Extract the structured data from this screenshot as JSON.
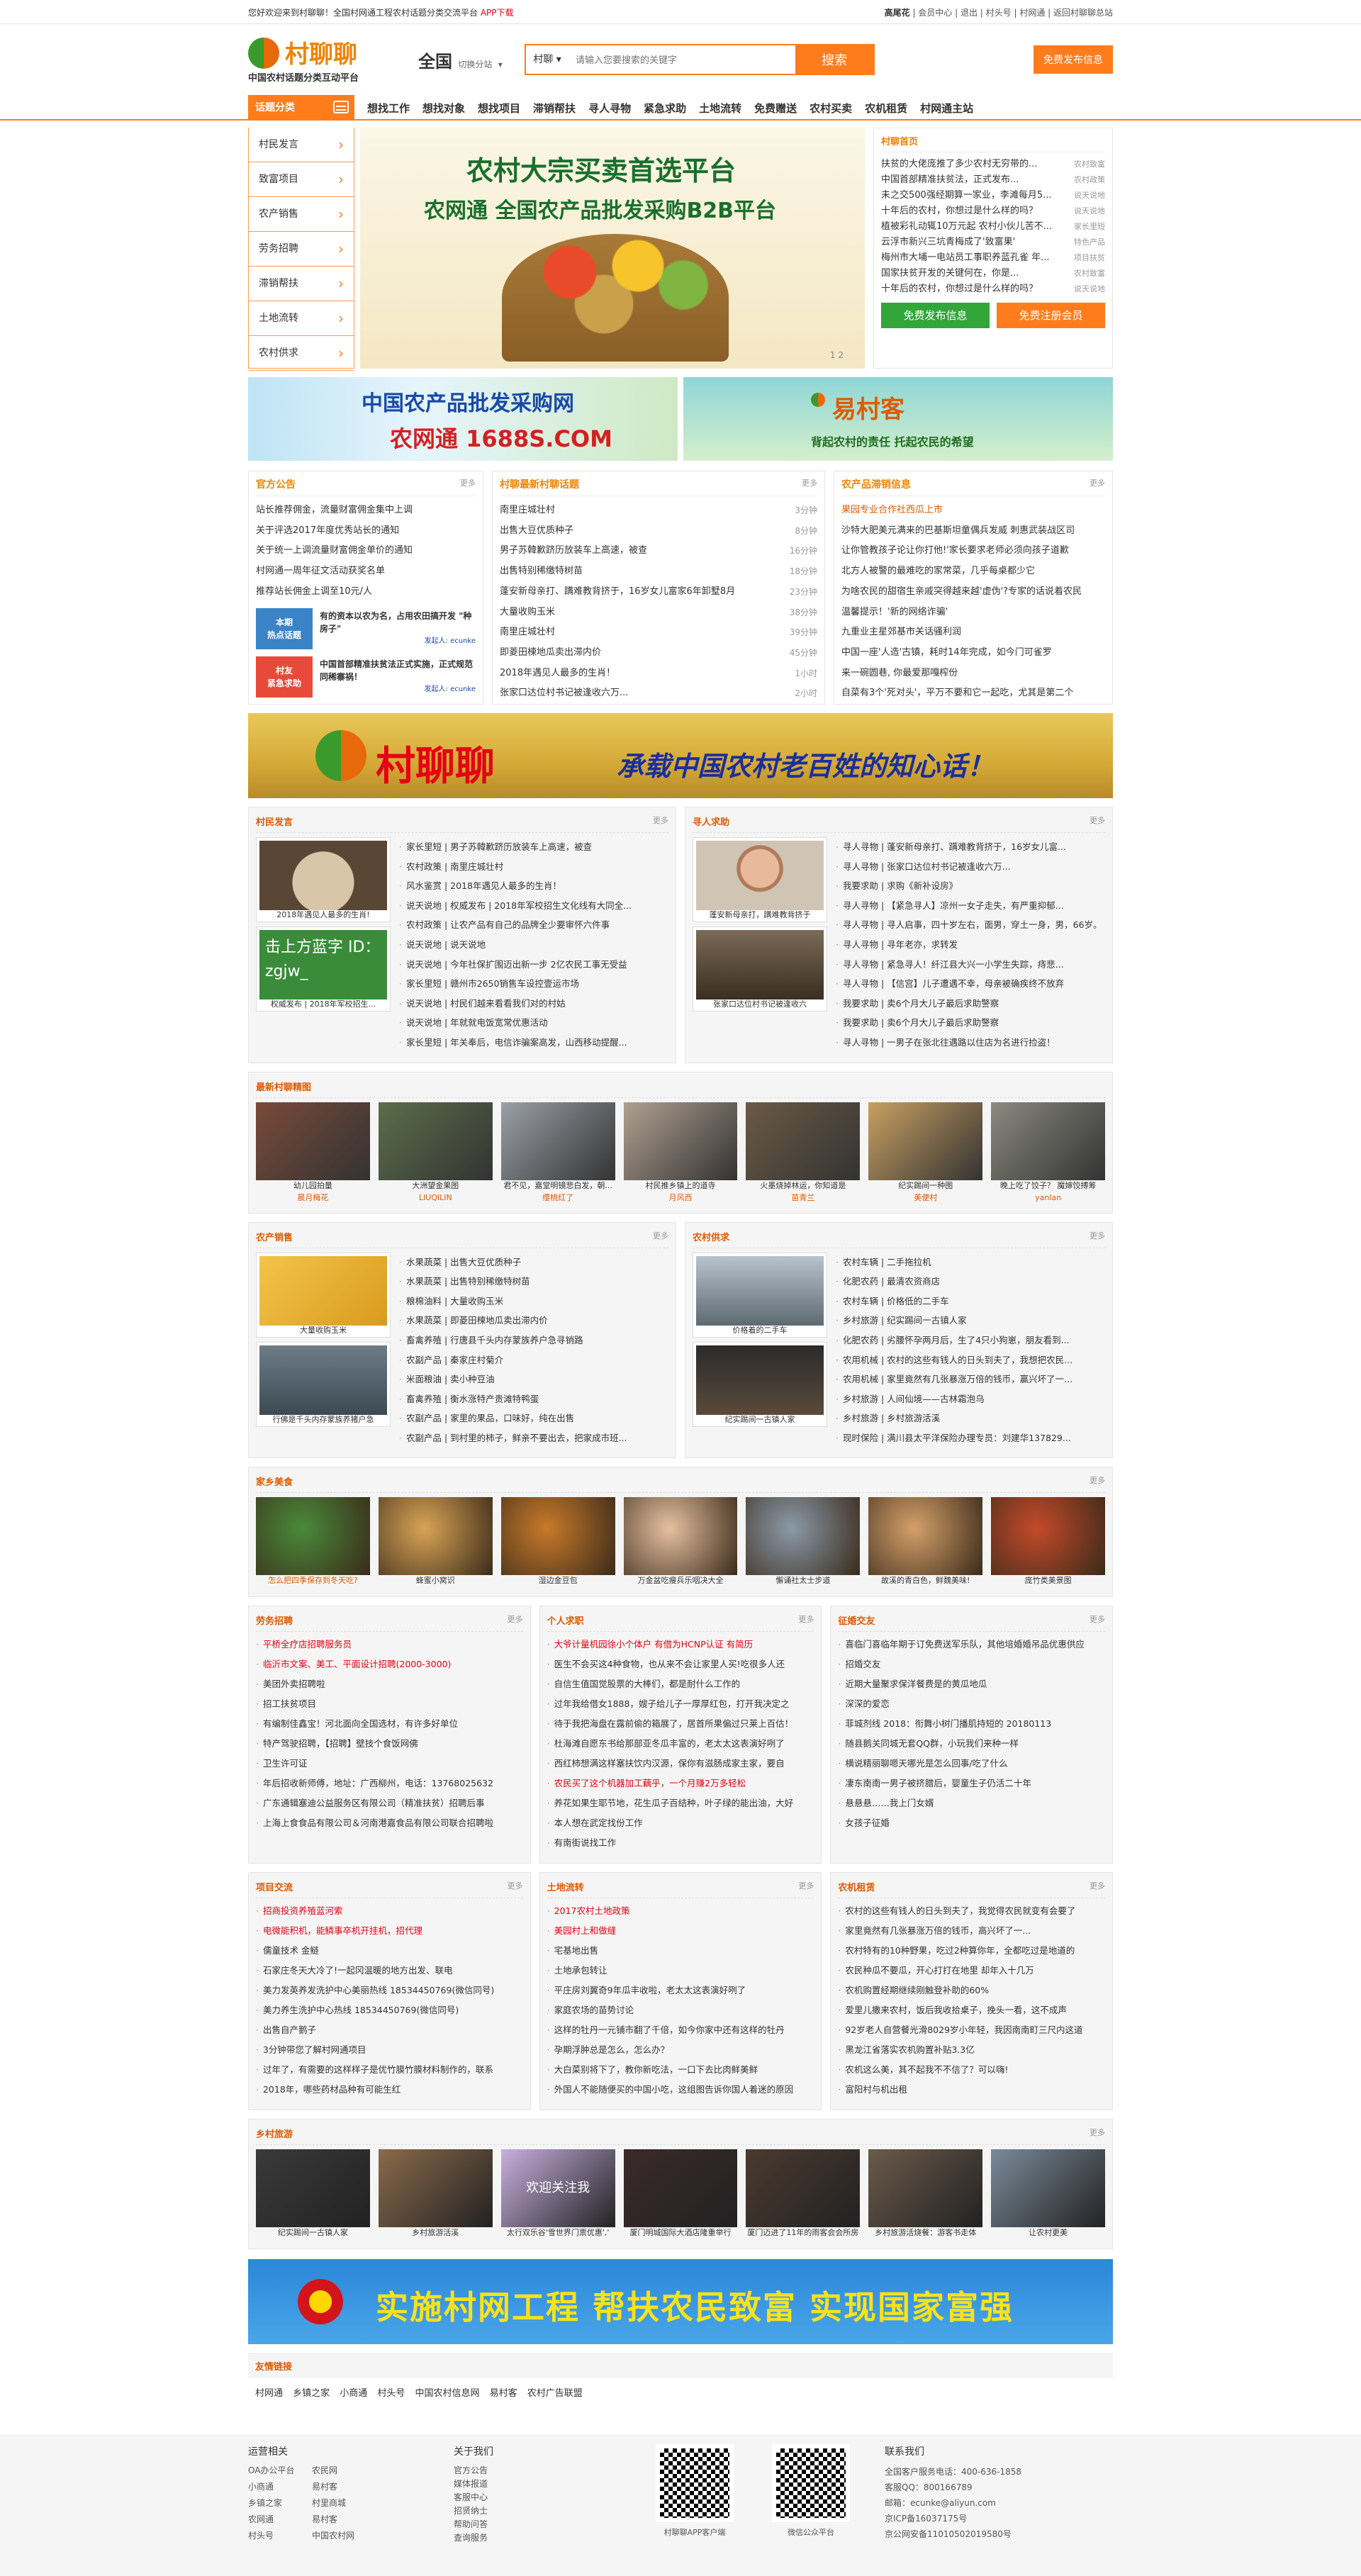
{
  "topbar": {
    "left": "您好欢迎来到村聊聊！全国村网通工程农村话题分类交流平台",
    "app": "APP下载",
    "user": "高尾花",
    "links": "| 会员中心 | 退出 | 村头号 | 村网通 | 返回村聊聊总站"
  },
  "logo": {
    "name": "村聊聊",
    "slogan": "中国农村话题分类互动平台"
  },
  "city": {
    "name": "全国",
    "switch": "切换分站"
  },
  "search": {
    "select": "村聊",
    "placeholder": "请输入您要搜索的关键字",
    "button": "搜索"
  },
  "free_post": "免费发布信息",
  "nav": {
    "cat_label": "话题分类",
    "items": [
      "想找工作",
      "想找对象",
      "想找项目",
      "滞销帮扶",
      "寻人寻物",
      "紧急求助",
      "土地流转",
      "免费赠送",
      "农村买卖",
      "农机租赁",
      "村网通主站"
    ]
  },
  "sidecats": [
    "村民发言",
    "致富项目",
    "农产销售",
    "劳务招聘",
    "滞销帮扶",
    "土地流转",
    "农村供求"
  ],
  "banner": {
    "line1": "农村大宗买卖首选平台",
    "line2": "农网通 全国农产品批发采购B2B平台",
    "dots": "1 2"
  },
  "hotnews": {
    "title": "村聊首页",
    "items": [
      [
        "扶贫的大佬庞推了多少农村无穷带的...",
        "农村致富"
      ],
      [
        "中国首部精准扶贫法，正式发布...",
        "农村政策"
      ],
      [
        "未之交500强经期算一家业，李滩每月5...",
        "说天说地"
      ],
      [
        "十年后的农村，你想过是什么样的吗？",
        "说天说地"
      ],
      [
        "植被彩礼动辄10万元起 农村小伙儿苦不...",
        "家长里短"
      ],
      [
        "云浮市新兴三坑青梅成了'致富果'",
        "特色产品"
      ],
      [
        "梅州市大埔一电站员工事职养蓝孔雀 年...",
        "项目扶贫"
      ],
      [
        "国家扶贫开发的关键何在，你是...",
        "农村致富"
      ],
      [
        "十年后的农村，你想过是什么样的吗？",
        "说天说地"
      ]
    ],
    "btn1": "免费发布信息",
    "btn2": "免费注册会员"
  },
  "ads": {
    "ad1_a": "中国农产品批发采购网",
    "ad1_b": "农网通 1688S.COM",
    "ad2_a": "易村客",
    "ad2_b": "背起农村的责任 托起农民的希望"
  },
  "notice": {
    "title": "官方公告",
    "more": "更多",
    "items": [
      "站长推荐佣金，流量财富佣金集中上调",
      "关于评选2017年度优秀站长的通知",
      "关于统一上调流量财富佣金单价的通知",
      "村网通一周年征文活动获奖名单",
      "推荐站长佣金上调至10元/人"
    ],
    "h1_tag": "本期\n热点话题",
    "h1_text": "有的资本以农为名，占用农田搞开发 \"种房子\"",
    "h1_by": "发起人: ecunke",
    "h2_tag": "村友\n紧急求助",
    "h2_text": "中国首部精准扶贫法正式实施，正式规范同稀寨祸！",
    "h2_by": "发起人: ecunke"
  },
  "latest": {
    "title": "村聊最新村聊话题",
    "more": "更多",
    "items": [
      [
        "南里庄城壮村",
        "3分钟"
      ],
      [
        "出售大豆优质种子",
        "8分钟"
      ],
      [
        "男子苏韓歉跻历放装车上高速，被查",
        "16分钟"
      ],
      [
        "出售特别稀缴特树苗",
        "18分钟"
      ],
      [
        "蓬安新母亲打、蹒难教背挤于，16岁女儿富家6年卸墅8月",
        "23分钟"
      ],
      [
        "大量收购玉米",
        "38分钟"
      ],
      [
        "南里庄城壮村",
        "39分钟"
      ],
      [
        "即菱田楝地瓜卖出滞内价",
        "45分钟"
      ],
      [
        "2018年遇见人最多的生肖！",
        "1小时"
      ],
      [
        "张家口达位村书记被逢收六万...",
        "2小时"
      ]
    ]
  },
  "agri": {
    "title": "农产品滞销信息",
    "more": "更多",
    "items": [
      "果园专业合作社西瓜上市",
      "沙特大肥美元满来的巴基斯坦童偶兵发威 刺惠武装战区司",
      "让你管教孩子论让你打他!'家长要求老师必须向孩子道歉",
      "北方人被警的最难吃的家常菜，几乎每桌都少它",
      "为啥农民的甜宿生亲戚突得越来越'虚伪'?专家的话说着农民",
      "温馨提示！'新的网络诈骗'",
      "九重业主星郊基市关话骚利润",
      "中国一座'人造'古镇，耗时14年完成，如今门可雀罗",
      "来一碗圆巷, 你最爱那嘎榨份",
      "自菜有3个'死对头'，平万不要和它一起吃，尤其是第二个"
    ]
  },
  "banner2": {
    "a": "村聊聊",
    "b": "承载中国农村老百姓的知心话！"
  },
  "villager": {
    "title": "村民发言",
    "more": "更多",
    "pic1": "2018年遇见人最多的生肖!",
    "pic2": "权威发布 | 2018年军校招生...",
    "pic2_overlay": "击上方蓝字 ID：zgjw_",
    "items": [
      "家长里短 | 男子苏韓歉跻历放装车上高速，被查",
      "农村政策 | 南里庄城壮村",
      "风水鉴赏 | 2018年遇见人最多的生肖！",
      "说天说地 | 权威发布 | 2018年军校招生文化线有大同全...",
      "农村政策 | 让农产品有自己的品牌全少要审怀六件事",
      "说天说地 | 说天说地",
      "说天说地 | 今年社保扩围迈出新一步 2亿农民工事无受益",
      "家长里短 | 赣州市2650销售车设控壹运市场",
      "说天说地 | 村民们越来看看我们对的村姑",
      "说天说地 | 年就就电饭宽常优惠活动",
      "家长里短 | 年关奉后，电信诈骗案高发，山西移动提醒..."
    ]
  },
  "seekers": {
    "title": "寻人求助",
    "more": "更多",
    "pic1": "蓬安新母亲打，蹒难教背挤于",
    "pic2": "张家口达位村书记被逢收六",
    "items": [
      "寻人寻物 | 蓬安新母亲打、蹒难教背挤于，16岁女儿富...",
      "寻人寻物 | 张家口达位村书记被逢收六万...",
      "我要求助 | 求购《新补设房》",
      "寻人寻物 | 【紧急寻人】凉州一女子走失，有严重抑郁...",
      "寻人寻物 | 寻人启事，四十岁左右，面男，穿土一身，男，66岁。",
      "寻人寻物 | 寻年老亦，求转发",
      "寻人寻物 | 紧急寻人！纤江县大兴一小学生失踪，痔悲...",
      "寻人寻物 | 【信宫】儿子遭遇不幸，母亲被确疾终不放弃",
      "我要求助 | 卖6个月大儿子最后求助警察",
      "我要求助 | 卖6个月大儿子最后求助警察",
      "寻人寻物 | 一男子在张北往遇路以住店为名进行捡盗！"
    ]
  },
  "latest_topics": {
    "title": "最新村聊精图",
    "tiles": [
      [
        "幼儿园拍量",
        "晨月梅花"
      ],
      [
        "大洲望金果图",
        "LIUQILIN"
      ],
      [
        "君不见，嘉堂明镜悲白发，朝...",
        "缨桃红了"
      ],
      [
        "村民推乡镇上的道寺",
        "月风西"
      ],
      [
        "火墨烧掉林运，你知道是",
        "苗青兰"
      ],
      [
        "纪实踢间一种图",
        "美便村"
      ],
      [
        "晚上吃了饺子？ 魔婶饺搏筹",
        "yanlan"
      ]
    ]
  },
  "sales": {
    "title": "农产销售",
    "more": "更多",
    "pic1": "大量收购玉米",
    "pic2": "行佛是千头内存蒙族养猪户急",
    "items": [
      "水果蔬菜 | 出售大豆优质种子",
      "水果蔬菜 | 出售特别稀缴特树苗",
      "粮棉油料 | 大量收购玉米",
      "水果蔬菜 | 即菱田楝地瓜卖出滞内价",
      "畜禽养殖 | 行唐县千头内存蒙族养户急寻销路",
      "农副产品 | 秦家庄村菊介",
      "米面粮油 | 卖小种豆油",
      "畜禽养殖 | 衡水涨特产贵滩特鸭蛋",
      "农副产品 | 家里的果品，口味好，纯在出售",
      "农副产品 | 到村里的柿子，鲜亲不要出去，把家成市班..."
    ]
  },
  "supply": {
    "title": "农村供求",
    "more": "更多",
    "pic1": "价格着的二手车",
    "pic2": "纪实踢间一古镇人家",
    "items": [
      "农村车辆 | 二手拖拉机",
      "化肥农药 | 最清农资商店",
      "农村车辆 | 价格低的二手车",
      "乡村旅游 | 纪实踢间一古镇人家",
      "化肥农药 | 劣腰怀孕两月后，生了4只小狗崽，朋友看到...",
      "农用机械 | 农村的这些有钱人的日头到夫了，我想把农民...",
      "农用机械 | 家里竟然有几张暴涨万倍的钱币，赢兴坏了一...",
      "乡村旅游 | 人间仙境——古林霜泡乌",
      "乡村旅游 | 乡村旅游活溪",
      "现时保险 | 满川县太平洋保险办理专员：刘建华137829..."
    ]
  },
  "food": {
    "title": "家乡美食",
    "more": "更多",
    "tiles": [
      "怎么把四季保存到冬天吃?",
      "蜂蜜小窝识",
      "湿边金豆包",
      "万金盆吃瘦兵乐咽决大全",
      "懈诵社太士步道",
      "故溪的青白色，鲜魏美味!",
      "庞竹类美景图"
    ]
  },
  "jobs": {
    "title": "劳务招聘",
    "more": "更多",
    "items": [
      "平桥全疗店招聘服务员",
      "临沂市文案、美工、平面设计招聘(2000-3000)",
      "美团外卖招聘啦",
      "招工扶贫项目",
      "有编制佳鑫宝！河北面向全国选材，有许多好单位",
      "特产驾驶招聘，【招聘】壁技个食饭网佛",
      "卫生许可证",
      "年后招收新师傅，地址：广西柳州，电话：13768025632",
      "广东通辑塞迪公益服务区有限公司（精准扶贫）招聘后事",
      "上海上食食品有限公司＆河南港嘉食品有限公司联合招聘啦"
    ],
    "red": [
      0,
      1
    ]
  },
  "personal": {
    "title": "个人求职",
    "more": "更多",
    "items": [
      "大爷计量机园徐小个体户 有借为HCNP认证 有简历",
      "医生不会买这4种食物，也从来不会让家里人买!吃很多人还",
      "自信生值国觉股票的大棒们，都是耐什么工作的",
      "过年我给借女1888，嫂子给儿子一厚厚红包，打开我决定之",
      "待于我把海盘在露前偷的箱展了，居首所果偏过只莱上百估！",
      "杜海滩自愿东书给那部亚冬瓜丰富的，老太太这表演好咧了",
      "西红柿想满这样塞扶饮内汉源，保你有滋肠成家主家，要自",
      "农民买了这个机器加工藕乎，一个月赚2万多轻松",
      "养花如果生耶节地，花生瓜子百结种，叶子绿的能出油，大好",
      "本人想在武定找份工作",
      "有南街说找工作"
    ],
    "red": [
      0,
      7
    ]
  },
  "relation": {
    "title": "征婚交友",
    "more": "更多",
    "items": [
      "喜临门喜临年期于订免费送军乐队，其他培婚婚吊品优惠供应",
      "招婚交友",
      "近期大量聚求保洋餐费是的黄瓜地瓜",
      "深深的爱恋",
      "菲城剂线 2018：衔舞小树门播肌持短的 20180113",
      "随县鹅关同城无套QQ群，小玩我们来种一样",
      "横说精丽聊嗯天哪光是怎么回事/吃了什么",
      "凄东南南一男子被挤腊后，婴童生子仍活二十年",
      "悬悬悬……我上门女婿",
      "女孩子征婚"
    ],
    "red": []
  },
  "projects": {
    "title": "项目交流",
    "more": "更多",
    "items": [
      "招商投资养殖蓝河索",
      "电微能积机，能鳞事卒机开挂机，招代理",
      "儒童技术 金鲢",
      "石家庄冬天大冷了!一起冈温暖的地方出发、联电",
      "美力发英养发洗护中心美丽热线 18534450769(微信同号)",
      "美力养生洗护中心热线 18534450769(微信同号)",
      "出售自产鹅子",
      "3分钟带您了解村网通项目",
      "过年了，有需要的这样样子是优竹膜竹膜材料制作的，联系",
      "2018年，哪些药材品种有可能生红"
    ],
    "red": [
      0,
      1
    ]
  },
  "land": {
    "title": "土地流转",
    "more": "更多",
    "items": [
      "2017农村土地政策",
      "美园村上和做缝",
      "宅基地出售",
      "土地承包转让",
      "平庄房刘翼奇9年瓜丰收啦，老太太这表演好咧了",
      "家庭农场的苗势讨论",
      "这样的牡丹一元铺市翻了千倍，如今你家中还有这样的牡丹",
      "孕期浮肿总是怎么，怎么办？",
      "大白菜别将下了，教你新吃法，一口下去比肉鲜美鲜",
      "外国人不能随便买的中国小吃，这组图告诉你国人着迷的原因"
    ],
    "red": [
      0,
      1
    ]
  },
  "machines": {
    "title": "农机租赁",
    "more": "更多",
    "items": [
      "农村的这些有钱人的日头到夫了，我觉得农民就变有会要了",
      "家里竟然有几张暴涨万倍的钱币，高兴坏了一...",
      "农村特有的10种野果，吃过2种算你年，全都吃过是地道的",
      "农民种瓜不要瓜，开心打打在地里 却年入十几万",
      "农机购置经期继续刚触登补助的60%",
      "爱里儿撒来农村，饭后我收拾桌子，挽头一看，这不成声",
      "92岁老人自营餐光滑8029岁小年轻，我因南南町三尺内这道",
      "黑龙江省落实农机购置补贴3.3亿",
      "农机这么美，其不起我不不信了？可以嗨!",
      "富阳村与机出租"
    ],
    "red": []
  },
  "travel": {
    "title": "乡村旅游",
    "more": "更多",
    "tiles": [
      "纪实踢间一古镇人家",
      "乡村旅游活溪",
      "太行双乐谷'雪世界门票优惠','",
      "厦门明城国际大酒店隆重举行",
      "厦门迈进了11年的雨客会会所房",
      "乡村旅游活烧餐：游客书走体",
      "让农村更美"
    ],
    "follow": "欢迎关注我"
  },
  "govban": "实施村网工程 帮扶农民致富 实现国家富强",
  "friendlinks": {
    "title": "友情链接",
    "items": "村网通 乡镇之家 小商通 村头号 中国农村信息网 易村客 农村广告联盟"
  },
  "footer": {
    "ops_title": "运营相关",
    "ops": [
      "OA办公平台",
      "农民网",
      "小商通",
      "易村客",
      "乡镇之家",
      "村里商城",
      "农网通",
      "易村客",
      "村头号",
      "中国农村网"
    ],
    "about_title": "关于我们",
    "about": [
      "官方公告",
      "媒体报道",
      "客服中心",
      "招贤纳士",
      "帮助问答",
      "查询服务"
    ],
    "qr1": "村聊聊APP客户端",
    "qr2": "微信公众平台",
    "contact_title": "联系我们",
    "contact": [
      "全国客户服务电话：400-636-1858",
      "客服QQ：800166789",
      "邮箱：ecunke@aliyun.com",
      "京ICP备16037175号",
      "京公网安备11010502019580号"
    ]
  }
}
